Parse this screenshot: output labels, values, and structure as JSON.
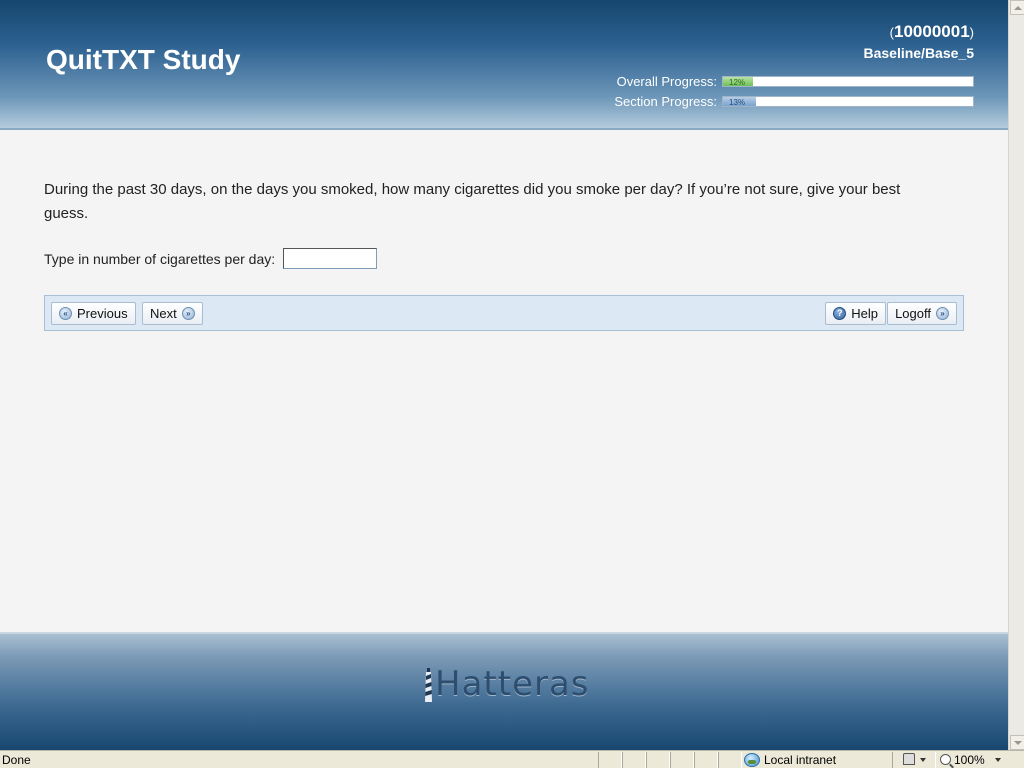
{
  "header": {
    "title": "QuitTXT Study",
    "participant_id": "10000001",
    "paren_open": "(",
    "paren_close": ")",
    "section_name": "Baseline/Base_5",
    "overall_label": "Overall Progress:",
    "overall_percent": 12,
    "overall_text": "12%",
    "section_label": "Section Progress:",
    "section_percent": 13,
    "section_text": "13%"
  },
  "question": {
    "text": "During the past 30 days, on the days you smoked, how many cigarettes did you smoke per day? If you’re not sure, give your best guess.",
    "input_label": "Type in number of cigarettes per day:",
    "input_value": ""
  },
  "nav": {
    "previous_label": "Previous",
    "next_label": "Next",
    "help_label": "Help",
    "logoff_label": "Logoff"
  },
  "footer": {
    "logo_text": "Hatteras"
  },
  "statusbar": {
    "status_text": "Done",
    "zone_text": "Local intranet",
    "zoom_text": "100%"
  },
  "colors": {
    "header_dark": "#15466e",
    "overall_fill": "#6fbf58",
    "section_fill": "#7aa2cf",
    "navbar_bg": "#dde8f5"
  }
}
